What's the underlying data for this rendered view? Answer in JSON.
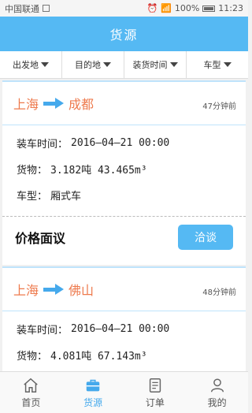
{
  "status_bar": {
    "carrier": "中国联通",
    "battery": "100%",
    "time": "11:23"
  },
  "header": {
    "title": "货源"
  },
  "filters": [
    {
      "label": "出发地"
    },
    {
      "label": "目的地"
    },
    {
      "label": "装货时间"
    },
    {
      "label": "车型"
    }
  ],
  "cards": [
    {
      "from": "上海",
      "to": "成都",
      "ago": "47分钟前",
      "load_time_label": "装车时间：",
      "load_time": "2016—04—21 00:00",
      "goods_label": "货物：",
      "goods": "3.182吨 43.465m³",
      "vehicle_label": "车型：",
      "vehicle": "厢式车",
      "price_label": "价格面议",
      "button": "洽谈"
    },
    {
      "from": "上海",
      "to": "佛山",
      "ago": "48分钟前",
      "load_time_label": "装车时间：",
      "load_time": "2016—04—21 00:00",
      "goods_label": "货物：",
      "goods": "4.081吨 67.143m³"
    }
  ],
  "tabs": [
    {
      "label": "首页",
      "icon": "home-icon"
    },
    {
      "label": "货源",
      "icon": "briefcase-icon",
      "active": true
    },
    {
      "label": "订单",
      "icon": "order-list-icon"
    },
    {
      "label": "我的",
      "icon": "user-icon"
    }
  ],
  "colors": {
    "primary": "#55b9f3",
    "city": "#ee7a4d"
  }
}
